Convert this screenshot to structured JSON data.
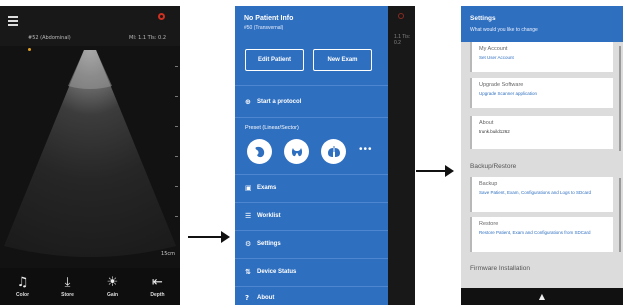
{
  "scan_screen": {
    "probe_label": "#52 (Abdominal)",
    "mi_tis": "MI: 1.1 TIs: 0.2",
    "depth_readout": "15cm",
    "controls": [
      {
        "label": "Color",
        "icon": "bell-icon",
        "glyph": "♫"
      },
      {
        "label": "Store",
        "icon": "download-tray-icon",
        "glyph": "⤓"
      },
      {
        "label": "Gain",
        "icon": "sun-icon",
        "glyph": "☀"
      },
      {
        "label": "Depth",
        "icon": "depth-icon",
        "glyph": "⇤"
      }
    ]
  },
  "side_menu": {
    "patient_title": "No Patient Info",
    "probe_label": "#50 (Transvernal)",
    "edit_patient_label": "Edit Patient",
    "new_exam_label": "New Exam",
    "start_protocol_label": "Start a protocol",
    "preset_label": "Preset (Linear/Sector)",
    "more_label": "•••",
    "preset_icons": [
      "kidney-icon",
      "thyroid-icon",
      "lungs-icon"
    ],
    "items": [
      {
        "label": "Exams",
        "icon": "folder-icon"
      },
      {
        "label": "Worklist",
        "icon": "list-icon"
      },
      {
        "label": "Settings",
        "icon": "gear-icon"
      },
      {
        "label": "Device Status",
        "icon": "device-status-icon"
      },
      {
        "label": "About",
        "icon": "help-icon"
      }
    ],
    "behind_text": "1.1 Tis: 0.2"
  },
  "settings": {
    "title": "Settings",
    "subtitle": "What would you like to change",
    "cards_top": [
      {
        "title": "My Account",
        "detail": "Set User Account"
      },
      {
        "title": "Upgrade Software",
        "detail": "Upgrade Scanner application"
      },
      {
        "title": "About",
        "value": "trunk.build1262"
      }
    ],
    "section_backup": "Backup/Restore",
    "cards_backup": [
      {
        "title": "Backup",
        "detail": "Save Patient, Exam, Configurations and Logs to SDcard"
      },
      {
        "title": "Restore",
        "detail": "Restore Patient, Exam and Configurations from SDCard"
      }
    ],
    "section_firmware": "Firmware Installation"
  },
  "colors": {
    "menu_blue": "#2f6fc0",
    "dark_bg": "#121212",
    "record_red": "#d03020"
  }
}
